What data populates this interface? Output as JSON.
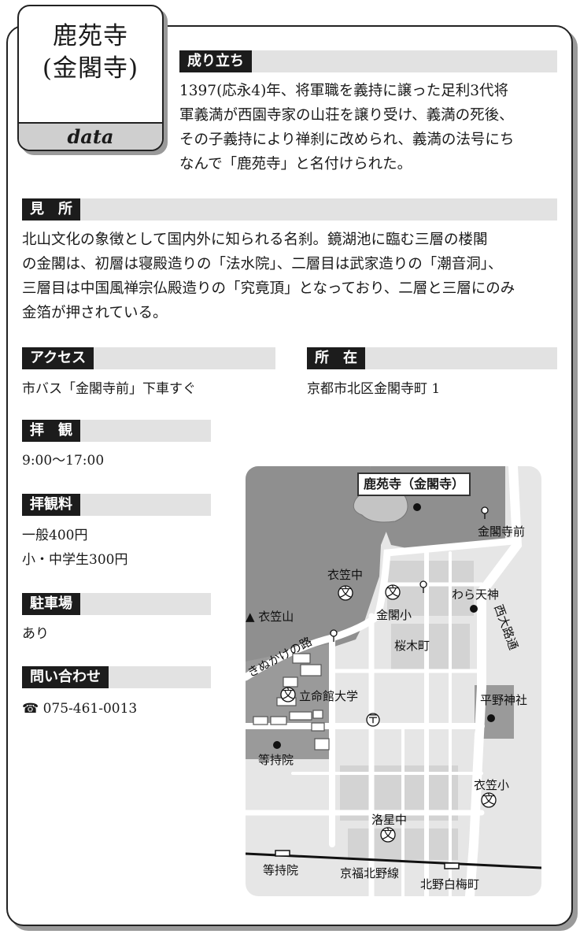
{
  "title": {
    "name": "鹿苑寺",
    "alt_name": "(金閣寺)",
    "data_label": "data"
  },
  "origin": {
    "heading": "成り立ち",
    "lines": [
      "1397(応永4)年、将軍職を義持に譲った足利3代将",
      "軍義満が西園寺家の山荘を譲り受け、義満の死後、",
      "その子義持により禅刹に改められ、義満の法号にち",
      "なんで「鹿苑寺」と名付けられた。"
    ]
  },
  "highlights": {
    "heading": "見　所",
    "lines": [
      "北山文化の象徴として国内外に知られる名刹。鏡湖池に臨む三層の楼閣",
      "の金閣は、初層は寝殿造りの「法水院」、二層目は武家造りの「潮音洞」、",
      "三層目は中国風禅宗仏殿造りの「究竟頂」となっており、二層と三層にのみ",
      "金箔が押されている。"
    ]
  },
  "access": {
    "heading": "アクセス",
    "text": "市バス「金閣寺前」下車すぐ"
  },
  "location": {
    "heading": "所　在",
    "text": "京都市北区金閣寺町 1"
  },
  "hours": {
    "heading": "拝　観",
    "text": "9:00〜17:00"
  },
  "fee": {
    "heading": "拝観料",
    "general": "一般400円",
    "students": "小・中学生300円"
  },
  "parking": {
    "heading": "駐車場",
    "text": "あり"
  },
  "contact": {
    "heading": "問い合わせ",
    "phone": "☎ 075-461-0013"
  },
  "map": {
    "title": "鹿苑寺（金閣寺）",
    "labels": {
      "kinkakuji_mae": "金閣寺前",
      "kinugasa_jh": "衣笠中",
      "kinkaku_es": "金閣小",
      "warabi": "わら天神",
      "kinugasa_mt": "▲ 衣笠山",
      "kinukake": "きぬかけの路",
      "sakuragi": "桜木町",
      "nishioji": "西大路通",
      "ritsumeikan": "立命館大学",
      "hirano": "平野神社",
      "tojiin": "等持院",
      "kinugasa_es": "衣笠小",
      "rakusei": "洛星中",
      "tojiin_st": "等持院",
      "keifuku": "京福北野線",
      "kitano_st": "北野白梅町"
    },
    "colors": {
      "park": "#8f8f8f",
      "block": "#c7c7c7",
      "road": "#ffffff"
    }
  }
}
